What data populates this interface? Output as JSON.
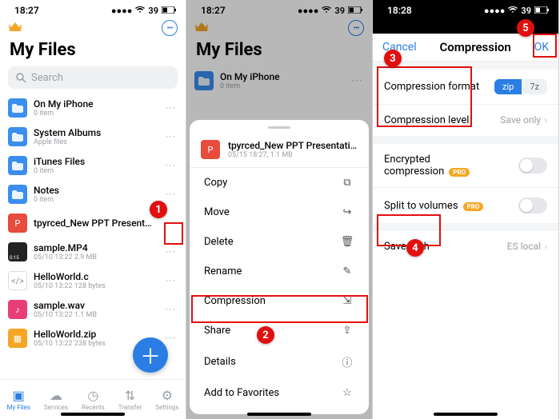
{
  "pane1": {
    "status_time": "18:27",
    "battery": "39",
    "title": "My Files",
    "search_placeholder": "Search",
    "items": [
      {
        "icon": "folder",
        "name": "On My iPhone",
        "meta": "0 item"
      },
      {
        "icon": "folder",
        "name": "System Albums",
        "meta": "Apple files"
      },
      {
        "icon": "folder",
        "name": "iTunes Files",
        "meta": "0 item"
      },
      {
        "icon": "folder",
        "name": "Notes",
        "meta": "0 item"
      },
      {
        "icon": "ppt",
        "name": "tpyrced_New PPT Presentation.ppt",
        "meta": ""
      },
      {
        "icon": "vid",
        "name": "sample.MP4",
        "meta": "05/10 13:22   2.9 MB"
      },
      {
        "icon": "code",
        "name": "HelloWorld.c",
        "meta": "05/10 13:22   128 bytes"
      },
      {
        "icon": "aud",
        "name": "sample.wav",
        "meta": "05/10 13:22   1.1 MB"
      },
      {
        "icon": "zip",
        "name": "HelloWorld.zip",
        "meta": "05/10 13:22   238 bytes"
      }
    ],
    "bottom": [
      "My Files",
      "Services",
      "Recents",
      "Transfer",
      "Settings"
    ]
  },
  "pane2": {
    "status_time": "18:27",
    "battery": "39",
    "title": "My Files",
    "visible_folder": {
      "name": "On My iPhone",
      "meta": "0 item"
    },
    "sheet_file": {
      "name": "tpyrced_New PPT Presentation.ppt",
      "meta": "05/15 18:27, 1.1 MB"
    },
    "actions": [
      "Copy",
      "Move",
      "Delete",
      "Rename",
      "Compression",
      "Share",
      "Details",
      "Add to Favorites"
    ]
  },
  "pane3": {
    "status_time": "18:28",
    "battery": "39",
    "cancel": "Cancel",
    "title": "Compression",
    "ok": "OK",
    "format_label": "Compression format",
    "format_options": [
      "zip",
      "7z"
    ],
    "level_label": "Compression level",
    "level_value": "Save only",
    "encrypted_label": "Encrypted compression",
    "split_label": "Split to volumes",
    "pro_badge": "PRO",
    "savepath_label": "Save path",
    "savepath_value": "ES local"
  },
  "callouts": {
    "c1": "1",
    "c2": "2",
    "c3": "3",
    "c4": "4",
    "c5": "5"
  }
}
